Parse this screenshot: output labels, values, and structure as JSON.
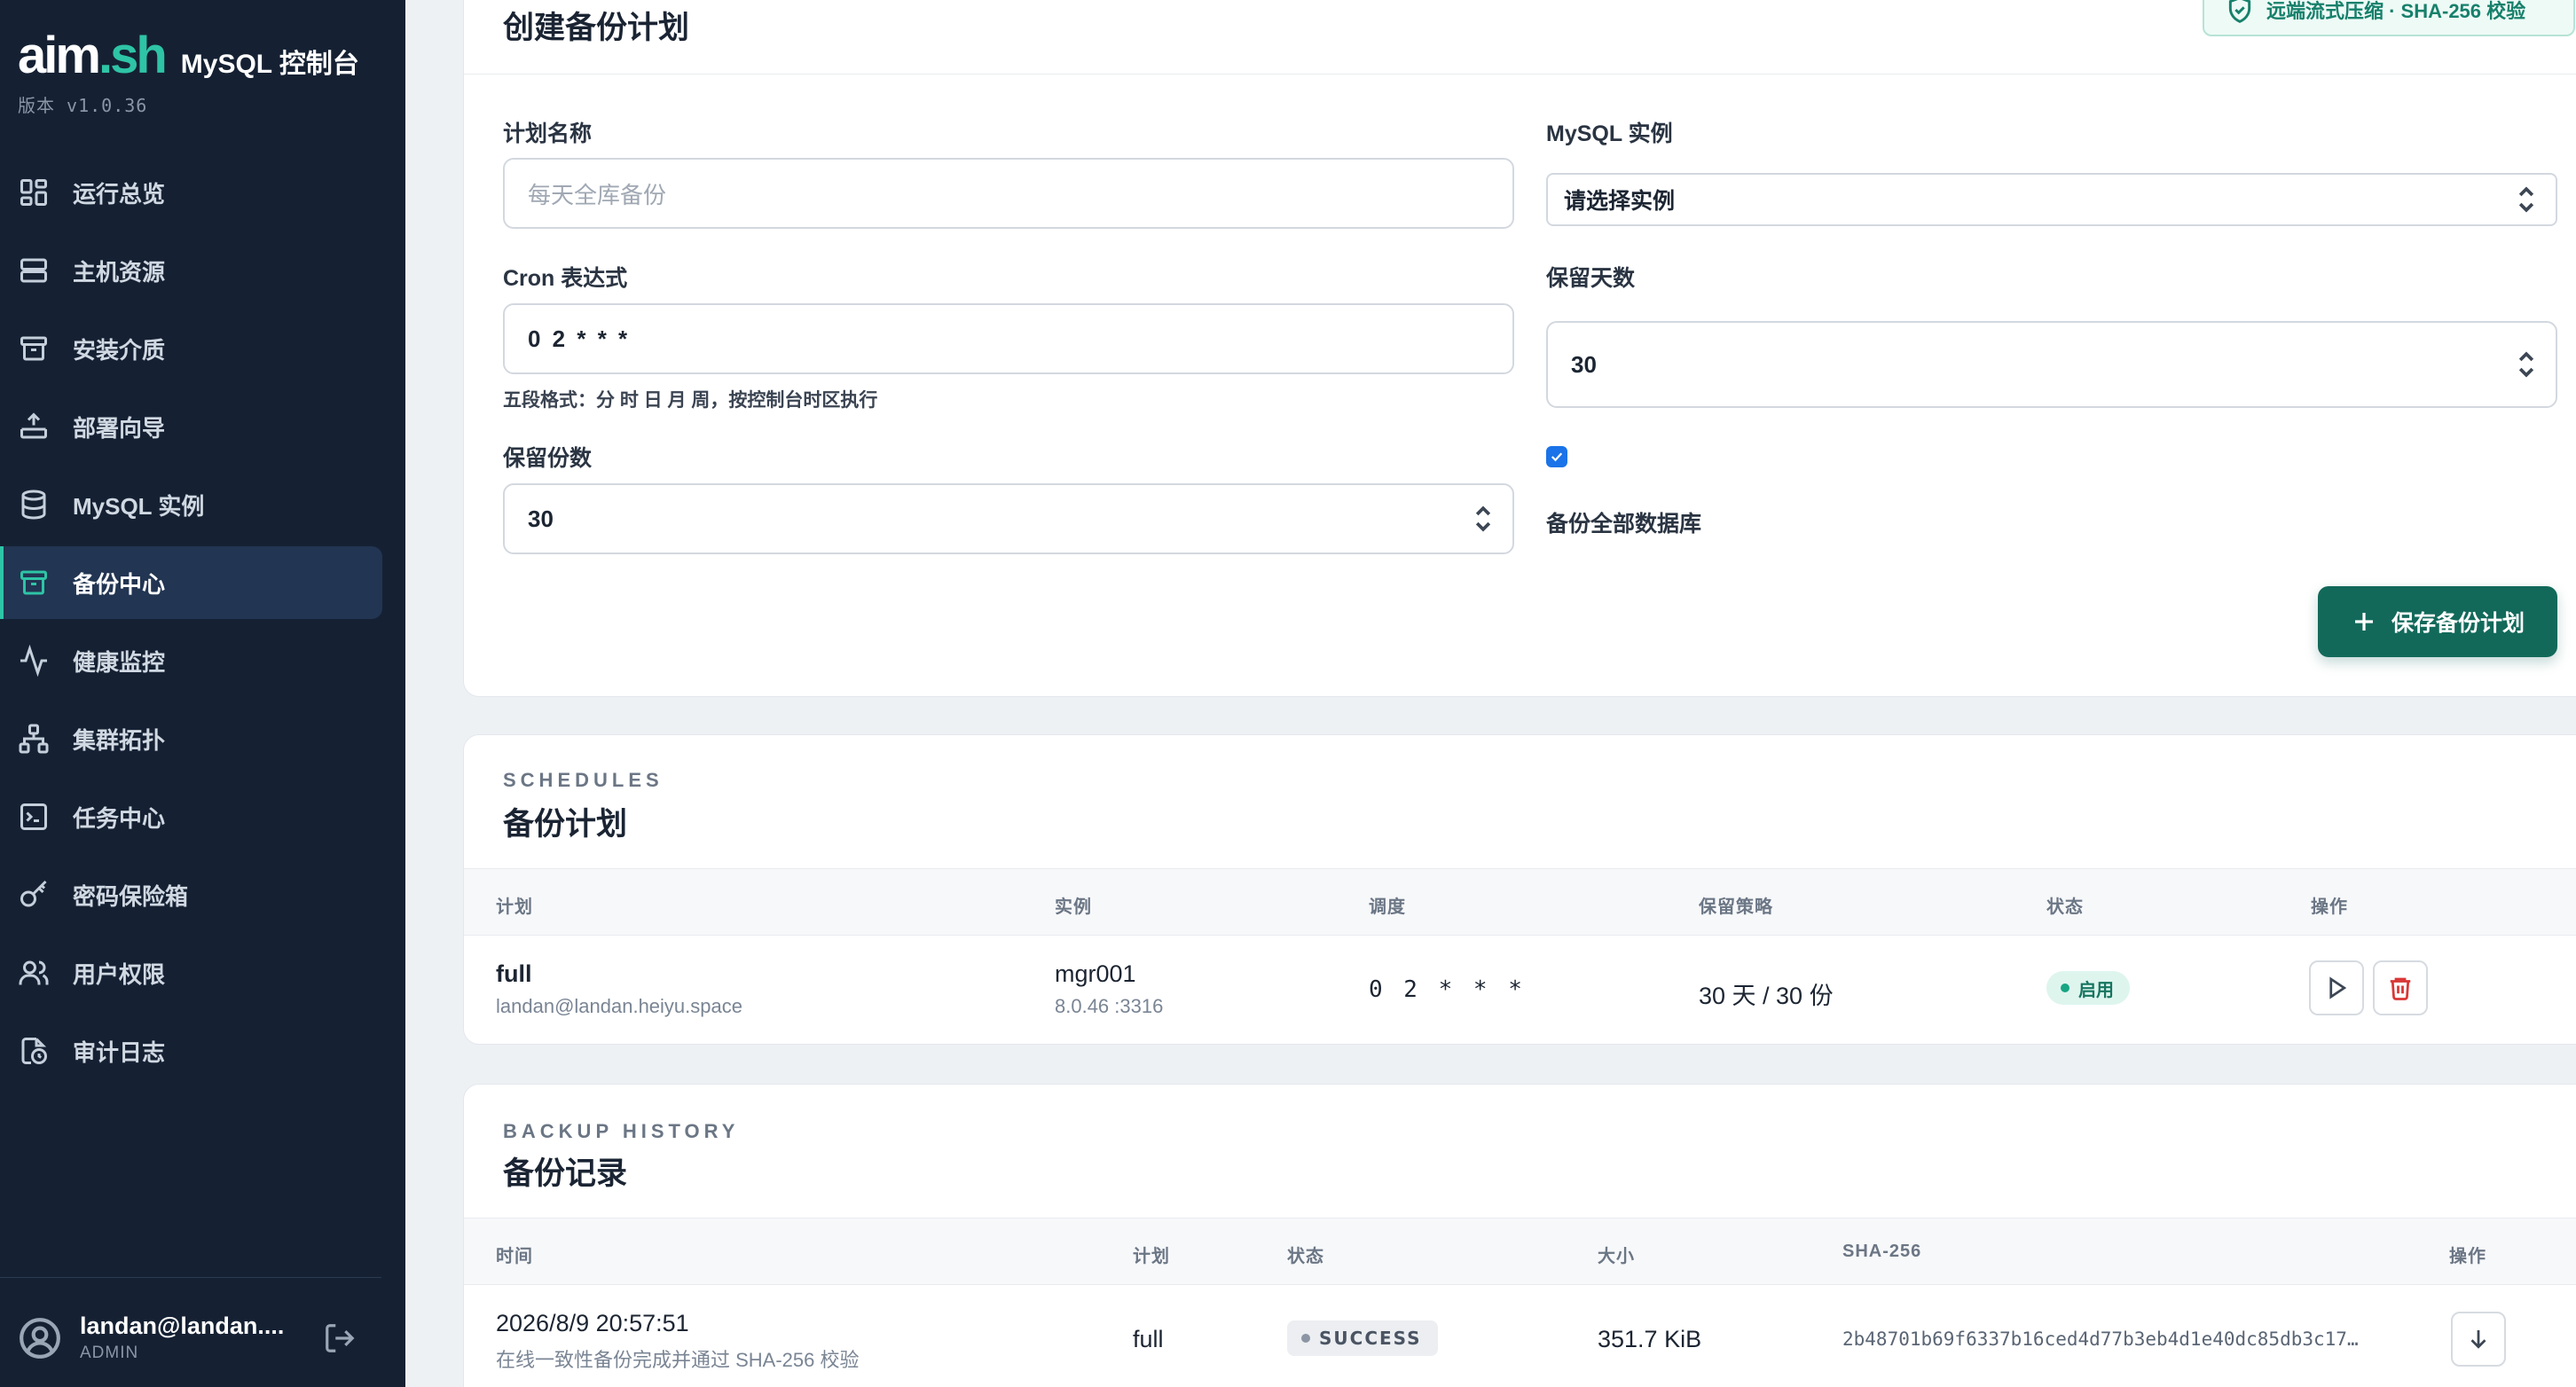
{
  "brand": {
    "logo_main": "aim",
    "logo_accent": ".sh",
    "title": "MySQL 控制台",
    "version": "版本 v1.0.36"
  },
  "nav": [
    {
      "label": "运行总览",
      "icon": "dashboard-grid-icon"
    },
    {
      "label": "主机资源",
      "icon": "server-icon"
    },
    {
      "label": "安装介质",
      "icon": "archive-box-icon"
    },
    {
      "label": "部署向导",
      "icon": "upload-tray-icon"
    },
    {
      "label": "MySQL 实例",
      "icon": "database-icon"
    },
    {
      "label": "备份中心",
      "icon": "archive-box-icon",
      "active": true
    },
    {
      "label": "健康监控",
      "icon": "activity-pulse-icon"
    },
    {
      "label": "集群拓扑",
      "icon": "topology-icon"
    },
    {
      "label": "任务中心",
      "icon": "terminal-icon"
    },
    {
      "label": "密码保险箱",
      "icon": "key-icon"
    },
    {
      "label": "用户权限",
      "icon": "users-icon"
    },
    {
      "label": "审计日志",
      "icon": "audit-log-icon"
    }
  ],
  "user": {
    "name": "landan@landan....",
    "role": "ADMIN"
  },
  "create": {
    "title": "创建备份计划",
    "verify_chip": "远端流式压缩 · SHA-256 校验",
    "plan_name_label": "计划名称",
    "plan_name_placeholder": "每天全库备份",
    "instance_label": "MySQL 实例",
    "instance_value": "请选择实例",
    "cron_label": "Cron 表达式",
    "cron_value": "0 2 * * *",
    "cron_hint": "五段格式：分 时 日 月 周，按控制台时区执行",
    "retain_days_label": "保留天数",
    "retain_days_value": "30",
    "retain_count_label": "保留份数",
    "retain_count_value": "30",
    "all_db_checked": true,
    "all_db_label": "备份全部数据库",
    "save_label": "保存备份计划"
  },
  "schedules": {
    "eyebrow": "SCHEDULES",
    "title": "备份计划",
    "columns": [
      "计划",
      "实例",
      "调度",
      "保留策略",
      "状态",
      "操作"
    ],
    "rows": [
      {
        "plan": "full",
        "owner": "landan@landan.heiyu.space",
        "instance": "mgr001",
        "instance_sub": "8.0.46 :3316",
        "cron": "0 2 * * *",
        "retention": "30 天 / 30 份",
        "status": "启用"
      }
    ]
  },
  "history": {
    "eyebrow": "BACKUP HISTORY",
    "title": "备份记录",
    "columns": [
      "时间",
      "计划",
      "状态",
      "大小",
      "SHA-256",
      "操作"
    ],
    "rows": [
      {
        "time": "2026/8/9 20:57:51",
        "note": "在线一致性备份完成并通过 SHA-256 校验",
        "plan": "full",
        "status": "SUCCESS",
        "size": "351.7 KiB",
        "sha": "2b48701b69f6337b16ced4d77b3eb4d1e40dc85db3c17…"
      }
    ]
  },
  "colors": {
    "sidebar_bg": "#152133",
    "accent": "#2ec4a6",
    "primary_button": "#12695a",
    "danger": "#d93636"
  }
}
